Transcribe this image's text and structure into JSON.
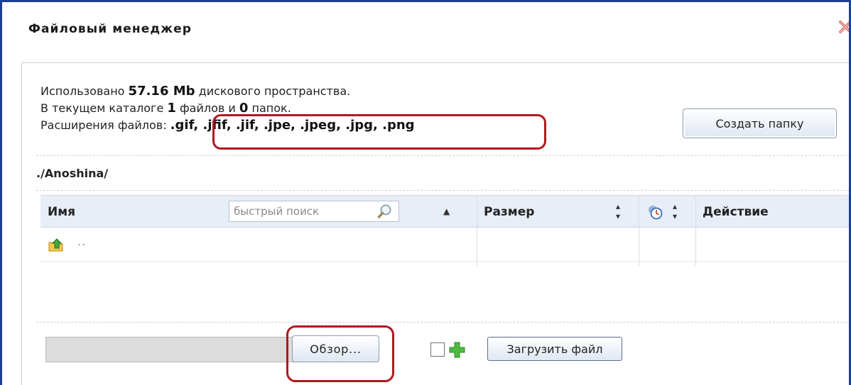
{
  "window": {
    "title": "Файловый менеджер"
  },
  "info": {
    "line1_prefix": "Использовано ",
    "used_space": "57.16 Mb",
    "line1_suffix": " дискового пространства.",
    "line2_prefix": "В текущем каталоге ",
    "files_count": "1",
    "line2_middle": " файлов и ",
    "folders_count": "0",
    "line2_suffix": " папок.",
    "ext_label": "Расширения файлов: ",
    "extensions": ".gif, .jfif, .jif, .jpe, .jpeg, .jpg, .png"
  },
  "toolbar": {
    "create_folder_label": "Создать папку"
  },
  "path": "./Anoshina/",
  "table": {
    "columns": {
      "name": "Имя",
      "size": "Размер",
      "action": "Действие"
    },
    "search_placeholder": "быстрый поиск",
    "rows": [
      {
        "name": ".."
      }
    ]
  },
  "upload": {
    "browse_label": "Обзор...",
    "upload_label": "Загрузить файл"
  },
  "colors": {
    "frame": "#1c3f95",
    "highlight": "#b1171f",
    "header_bg": "#e8eef7"
  },
  "icons": [
    "close-icon",
    "search-icon",
    "clock-icon",
    "up-folder-icon",
    "plus-icon"
  ]
}
